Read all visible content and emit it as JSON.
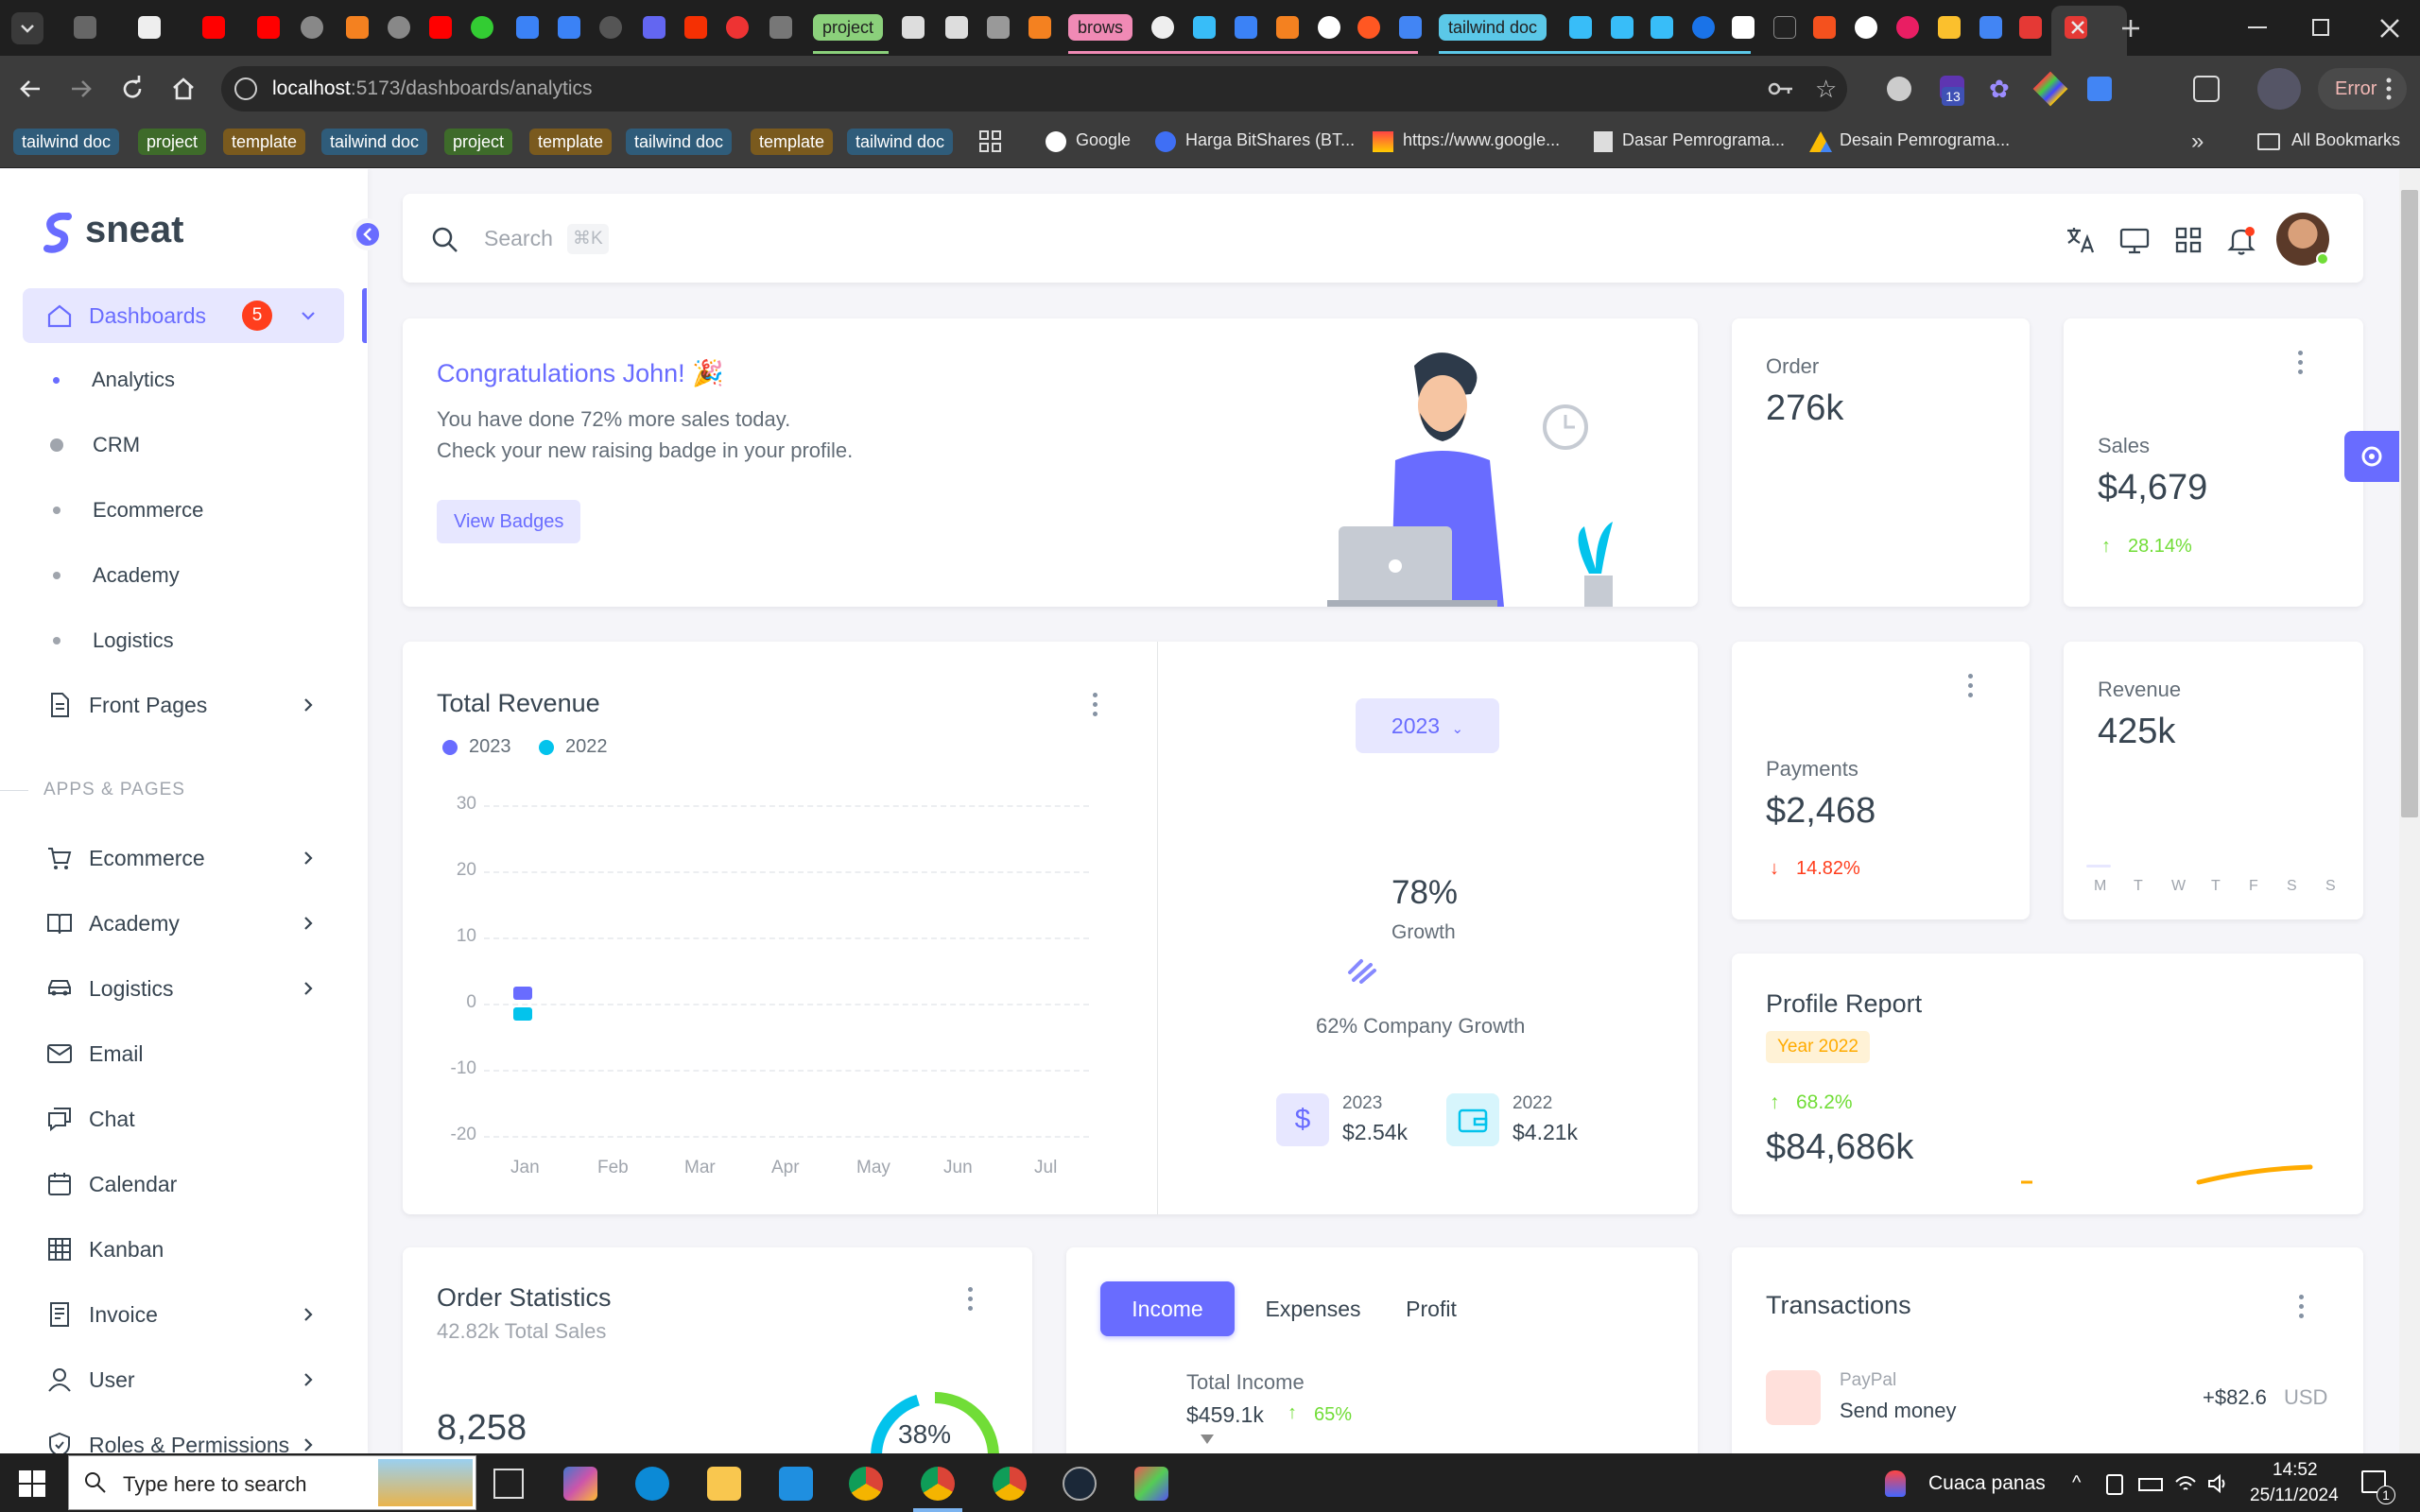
{
  "browser": {
    "tab_chips": {
      "project": "project",
      "brows": "brows",
      "tailwind_doc": "tailwind doc"
    },
    "url_host": "localhost",
    "url_path": ":5173/dashboards/analytics",
    "extension_badge": "13",
    "error_label": "Error",
    "bookmarks": {
      "chips": [
        "tailwind doc",
        "project",
        "template",
        "tailwind doc",
        "project",
        "template",
        "tailwind doc",
        "template",
        "tailwind doc"
      ],
      "links": [
        "Google",
        "Harga BitShares (BT...",
        "https://www.google...",
        "Dasar Pemrograma...",
        "Desain Pemrograma..."
      ],
      "all_bookmarks": "All Bookmarks"
    }
  },
  "sidebar": {
    "brand": "sneat",
    "dashboards_label": "Dashboards",
    "dashboards_badge": "5",
    "dashboard_items": [
      "Analytics",
      "CRM",
      "Ecommerce",
      "Academy",
      "Logistics"
    ],
    "front_pages": "Front Pages",
    "section_header": "APPS & PAGES",
    "apps": [
      "Ecommerce",
      "Academy",
      "Logistics",
      "Email",
      "Chat",
      "Calendar",
      "Kanban",
      "Invoice",
      "User",
      "Roles & Permissions"
    ]
  },
  "navbar": {
    "search_placeholder": "Search",
    "search_shortcut": "⌘K"
  },
  "welcome": {
    "title": "Congratulations John! 🎉",
    "line1": "You have done 72% more sales today.",
    "line2": "Check your new raising badge in your profile.",
    "button": "View Badges"
  },
  "order": {
    "label": "Order",
    "value": "276k"
  },
  "sales": {
    "label": "Sales",
    "value": "$4,679",
    "change": "28.14%"
  },
  "total_revenue": {
    "title": "Total Revenue",
    "legend": [
      "2023",
      "2022"
    ],
    "year_button": "2023",
    "growth_value": "78%",
    "growth_label": "Growth",
    "company_growth": "62% Company Growth",
    "y2023_label": "2023",
    "y2023_value": "$2.54k",
    "y2022_label": "2022",
    "y2022_value": "$4.21k"
  },
  "payments": {
    "label": "Payments",
    "value": "$2,468",
    "change": "14.82%"
  },
  "revenue": {
    "label": "Revenue",
    "value": "425k",
    "days": [
      "M",
      "T",
      "W",
      "T",
      "F",
      "S",
      "S"
    ]
  },
  "profile_report": {
    "title": "Profile Report",
    "badge": "Year 2022",
    "change": "68.2%",
    "value": "$84,686k"
  },
  "order_statistics": {
    "title": "Order Statistics",
    "subtitle": "42.82k Total Sales",
    "value": "8,258",
    "donut_label": "38%"
  },
  "income_tabs": {
    "tabs": [
      "Income",
      "Expenses",
      "Profit"
    ],
    "total_label": "Total Income",
    "total_value": "$459.1k",
    "change": "65%"
  },
  "transactions": {
    "title": "Transactions",
    "item_source": "PayPal",
    "item_desc": "Send money",
    "item_amount": "+$82.6",
    "item_currency": "USD"
  },
  "taskbar": {
    "search_placeholder": "Type here to search",
    "weather": "Cuaca panas",
    "time": "14:52",
    "date": "25/11/2024",
    "notif_count": "1"
  },
  "colors": {
    "primary": "#696cff",
    "info": "#03c3ec",
    "success": "#71dd37",
    "danger": "#ff3e1d",
    "warning": "#ffab00"
  },
  "chart_data": {
    "type": "bar",
    "title": "Total Revenue",
    "categories": [
      "Jan",
      "Feb",
      "Mar",
      "Apr",
      "May",
      "Jun",
      "Jul"
    ],
    "series": [
      {
        "name": "2023",
        "values": [
          2,
          null,
          null,
          null,
          null,
          null,
          null
        ]
      },
      {
        "name": "2022",
        "values": [
          -2,
          null,
          null,
          null,
          null,
          null,
          null
        ]
      }
    ],
    "yticks": [
      30,
      20,
      10,
      0,
      -10,
      -20
    ],
    "ylim": [
      -20,
      30
    ],
    "grid": true,
    "legend": "top-left"
  }
}
